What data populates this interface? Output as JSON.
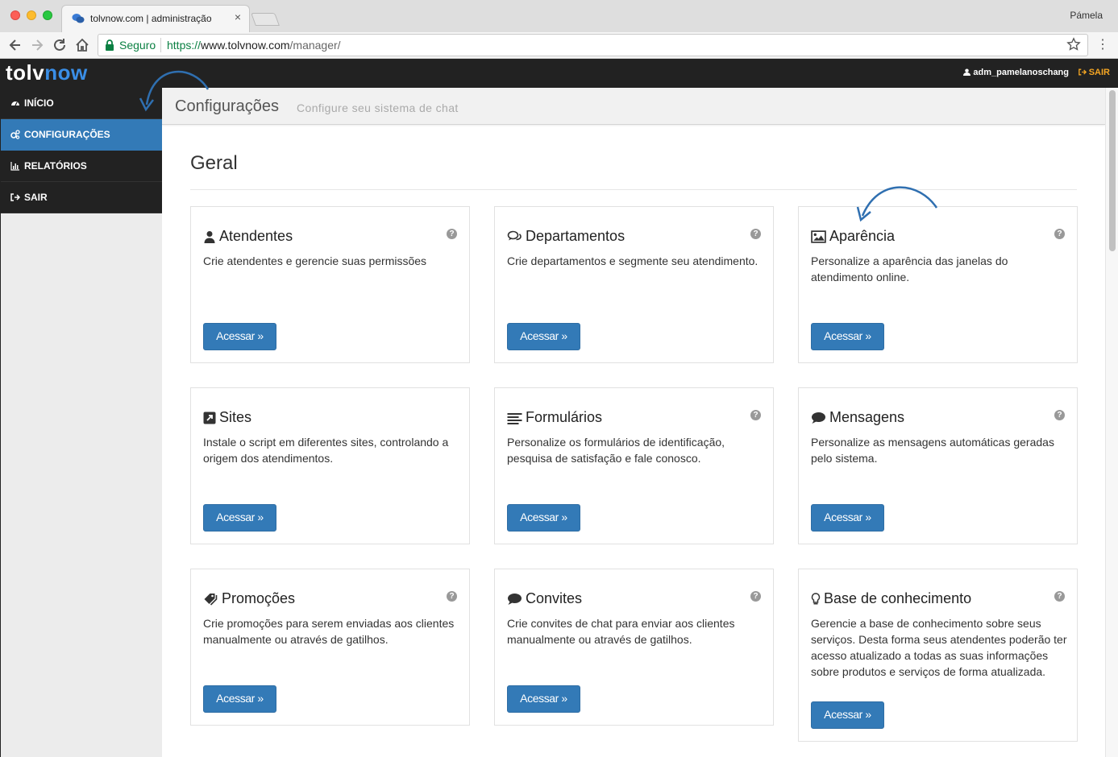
{
  "browser": {
    "tab_title": "tolvnow.com | administração",
    "tab_close": "×",
    "profile_name": "Pámela",
    "secure_label": "Seguro",
    "url_scheme": "https://",
    "url_host": "www.tolvnow.com",
    "url_path": "/manager/",
    "menu_icon": "⋮",
    "colors": {
      "secure": "#0b8043"
    }
  },
  "header": {
    "logo_part1": "tolv",
    "logo_part2": "now",
    "user_name": "adm_pamelanoschang",
    "logout_label": "SAIR",
    "colors": {
      "bar": "#222222",
      "logo_accent": "#3a8ee6",
      "logout": "#f5a623"
    }
  },
  "sidebar": {
    "items": [
      {
        "label": "INÍCIO",
        "icon": "dashboard-icon",
        "active": false
      },
      {
        "label": "CONFIGURAÇÕES",
        "icon": "cogs-icon",
        "active": true
      },
      {
        "label": "RELATÓRIOS",
        "icon": "bar-chart-icon",
        "active": false
      },
      {
        "label": "SAIR",
        "icon": "sign-out-icon",
        "active": false
      }
    ],
    "colors": {
      "active": "#337ab7"
    }
  },
  "page": {
    "title": "Configurações",
    "subtitle": "Configure seu sistema de chat",
    "section_title": "Geral"
  },
  "cards": [
    {
      "title": "Atendentes",
      "icon": "user-icon",
      "description": "Crie atendentes e gerencie suas permissões",
      "button": "Acessar »"
    },
    {
      "title": "Departamentos",
      "icon": "comments-icon",
      "description": "Crie departamentos e segmente seu atendimento.",
      "button": "Acessar »"
    },
    {
      "title": "Aparência",
      "icon": "picture-icon",
      "description": "Personalize a aparência das janelas do atendimento online.",
      "button": "Acessar »"
    },
    {
      "title": "Sites",
      "icon": "external-link-icon",
      "description": "Instale o script em diferentes sites, controlando a origem dos atendimentos.",
      "button": "Acessar »"
    },
    {
      "title": "Formulários",
      "icon": "list-icon",
      "description": "Personalize os formulários de identificação, pesquisa de satisfação e fale conosco.",
      "button": "Acessar »"
    },
    {
      "title": "Mensagens",
      "icon": "comment-icon",
      "description": "Personalize as mensagens automáticas geradas pelo sistema.",
      "button": "Acessar »"
    },
    {
      "title": "Promoções",
      "icon": "tags-icon",
      "description": "Crie promoções para serem enviadas aos clientes manualmente ou através de gatilhos.",
      "button": "Acessar »"
    },
    {
      "title": "Convites",
      "icon": "comment-icon",
      "description": "Crie convites de chat para enviar aos clientes manualmente ou através de gatilhos.",
      "button": "Acessar »"
    },
    {
      "title": "Base de conhecimento",
      "icon": "lightbulb-icon",
      "description": "Gerencie a base de conhecimento sobre seus serviços. Desta forma seus atendentes poderão ter acesso atualizado a todas as suas informações sobre produtos e serviços de forma atualizada.",
      "button": "Acessar »"
    }
  ],
  "help_glyph": "?",
  "colors": {
    "primary_button": "#337ab7",
    "annotation_arrow": "#2f6fb0"
  }
}
